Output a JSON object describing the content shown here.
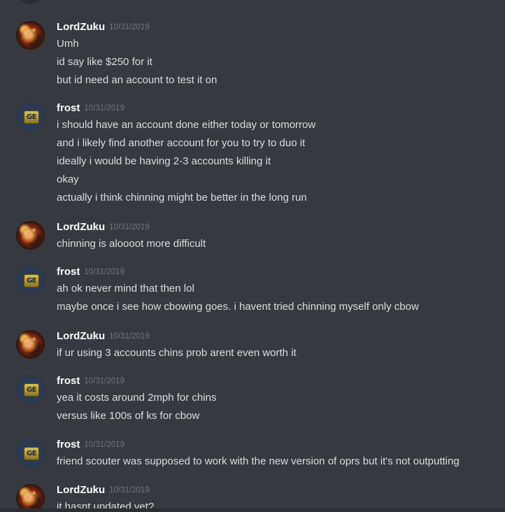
{
  "messages": [
    {
      "author": "LordZuku",
      "avatar": "flaming-character-avatar",
      "timestamp": "10/31/2019",
      "lines": [
        "Umh",
        "id say like $250 for it",
        "but id need an account to test it on"
      ]
    },
    {
      "author": "frost",
      "avatar": "ge-badge-avatar",
      "avatar_text": "GE",
      "timestamp": "10/31/2019",
      "lines": [
        "i should have an account done either today or tomorrow",
        "and i likely find another account for you to try to duo it",
        "ideally i would be having 2-3 accounts killing it",
        "okay",
        "actually i think chinning might be better in the long run"
      ]
    },
    {
      "author": "LordZuku",
      "avatar": "flaming-character-avatar",
      "timestamp": "10/31/2019",
      "lines": [
        "chinning is aloooot more difficult"
      ]
    },
    {
      "author": "frost",
      "avatar": "ge-badge-avatar",
      "avatar_text": "GE",
      "timestamp": "10/31/2019",
      "lines": [
        "ah ok never mind that then lol",
        "maybe once i see how cbowing goes. i havent tried chinning myself only cbow"
      ]
    },
    {
      "author": "LordZuku",
      "avatar": "flaming-character-avatar",
      "timestamp": "10/31/2019",
      "lines": [
        "if ur using 3 accounts chins prob arent even worth it"
      ]
    },
    {
      "author": "frost",
      "avatar": "ge-badge-avatar",
      "avatar_text": "GE",
      "timestamp": "10/31/2019",
      "lines": [
        "yea it costs around 2mph for chins",
        "versus like 100s of ks for cbow"
      ]
    },
    {
      "author": "frost",
      "avatar": "ge-badge-avatar",
      "avatar_text": "GE",
      "timestamp": "10/31/2019",
      "lines": [
        "friend scouter was supposed to work with the new version of oprs but it's not outputting"
      ]
    },
    {
      "author": "LordZuku",
      "avatar": "flaming-character-avatar",
      "timestamp": "10/31/2019",
      "lines": [
        "it hasnt updated yet?"
      ]
    }
  ],
  "colors": {
    "background": "#36393f",
    "username": "#ffffff",
    "timestamp": "#72767d",
    "message_text": "#dcddde"
  }
}
